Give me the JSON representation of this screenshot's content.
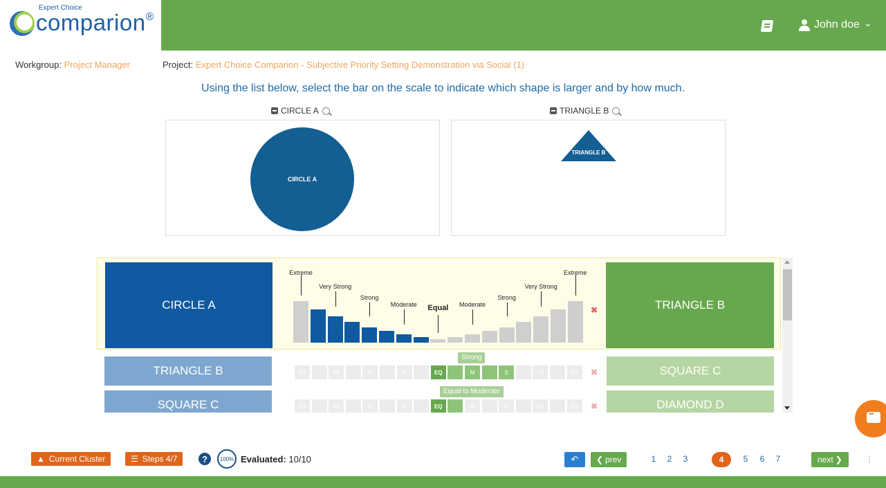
{
  "header": {
    "logo_small": "Expert Choice",
    "logo_big": "comparion",
    "logo_reg": "®",
    "user_name": "John doe",
    "user_caret": "⌄"
  },
  "meta": {
    "workgroup_label": "Workgroup:",
    "workgroup_value": "Project Manager",
    "project_label": "Project:",
    "project_value": "Expert Choice Comparion - Subjective Priority Setting Demonstration via Social (1)"
  },
  "instruction": "Using the list below, select the bar on the scale to indicate which shape is larger and by how much.",
  "left_image": {
    "caption": "CIRCLE A",
    "shape_text": "CIRCLE A",
    "color": "#135e92"
  },
  "right_image": {
    "caption": "TRIANGLE B",
    "shape_text": "TRIANGLE B",
    "color": "#135e92"
  },
  "active_comparison": {
    "left": "CIRCLE A",
    "right": "TRIANGLE B",
    "selected_side": "left",
    "selected_index": 1,
    "labels": {
      "extreme": "Extreme",
      "very_strong": "Very Strong",
      "strong": "Strong",
      "moderate": "Moderate",
      "equal": "Equal"
    },
    "clear": "✖"
  },
  "rows": [
    {
      "left": "TRIANGLE B",
      "right": "SQUARE C",
      "badge": "Strong",
      "segments": [
        "EX",
        "",
        "VS",
        "",
        "S",
        "",
        "M",
        "",
        "EQ",
        "",
        "M",
        "",
        "S",
        "",
        "VS",
        "",
        "EX"
      ],
      "selected_index": 12,
      "clear": "✖"
    },
    {
      "left": "SQUARE C",
      "right": "DIAMOND D",
      "badge": "Equal to Moderate",
      "segments": [
        "EX",
        "",
        "VS",
        "",
        "S",
        "",
        "M",
        "",
        "EQ",
        "",
        "M",
        "",
        "S",
        "",
        "VS",
        "",
        "EX"
      ],
      "selected_index": 9,
      "clear": "✖"
    }
  ],
  "footer": {
    "current_cluster": "Current Cluster",
    "steps": "Steps 4/7",
    "help": "?",
    "progress": "100%",
    "evaluated_label": "Evaluated:",
    "evaluated_value": "10/10",
    "undo": "↶",
    "prev": "prev",
    "next": "next",
    "pages": [
      "1",
      "2",
      "3",
      "4",
      "5",
      "6",
      "7"
    ],
    "current_page": "4",
    "more": "⋮"
  },
  "colors": {
    "brand_green": "#67a84e",
    "brand_blue": "#0f5aa0",
    "accent_orange": "#e0641a"
  }
}
